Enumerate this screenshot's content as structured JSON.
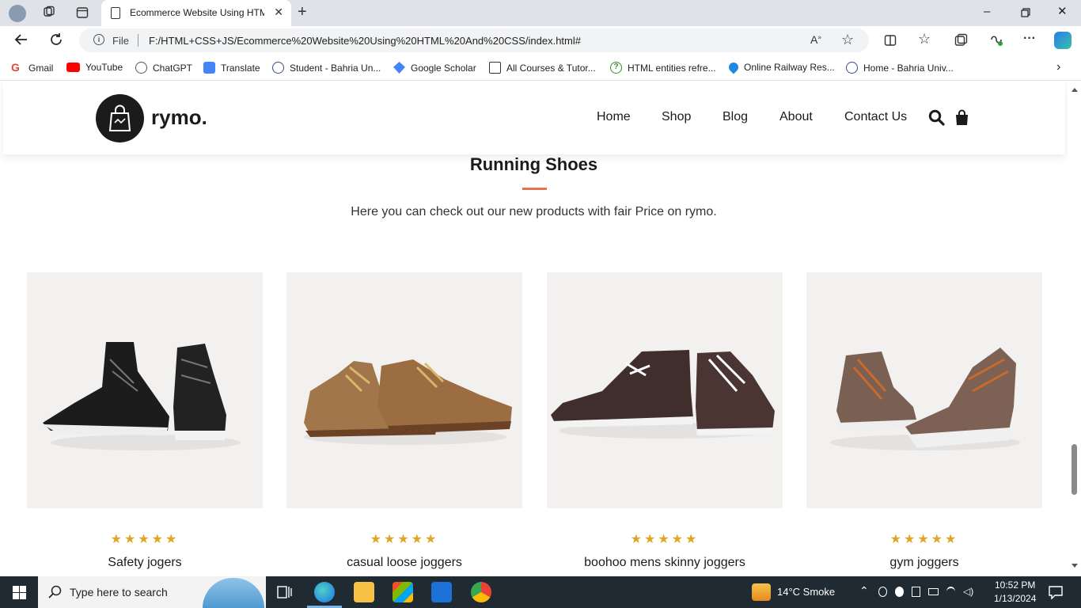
{
  "browser": {
    "tab_title": "Ecommerce Website Using HTML",
    "address_scheme": "File",
    "address_url": "F:/HTML+CSS+JS/Ecommerce%20Website%20Using%20HTML%20And%20CSS/index.html#",
    "bookmarks": [
      {
        "label": "Gmail",
        "icon": "gmail-icon",
        "color": "#ea4335"
      },
      {
        "label": "YouTube",
        "icon": "youtube-icon",
        "color": "#ff0000"
      },
      {
        "label": "ChatGPT",
        "icon": "chatgpt-icon",
        "color": "#555555"
      },
      {
        "label": "Translate",
        "icon": "translate-icon",
        "color": "#4285f4"
      },
      {
        "label": "Student - Bahria Un...",
        "icon": "bahria-icon",
        "color": "#3b4a8a"
      },
      {
        "label": "Google Scholar",
        "icon": "scholar-icon",
        "color": "#4285f4"
      },
      {
        "label": "All Courses & Tutor...",
        "icon": "courses-icon",
        "color": "#333333"
      },
      {
        "label": "HTML entities refre...",
        "icon": "html-entities-icon",
        "color": "#3a8a2a"
      },
      {
        "label": "Online Railway Res...",
        "icon": "railway-icon",
        "color": "#1e88e5"
      },
      {
        "label": "Home - Bahria Univ...",
        "icon": "bahria-icon",
        "color": "#3b4a8a"
      }
    ]
  },
  "site": {
    "logo_text": "rymo.",
    "nav": [
      "Home",
      "Shop",
      "Blog",
      "About",
      "Contact Us"
    ],
    "section_title": "Running Shoes",
    "section_subtitle": "Here you can check out our new products with fair Price on rymo.",
    "accent_color": "#e8734a",
    "star_color": "#e0a526",
    "products": [
      {
        "name": "Safety jogers",
        "rating": 5,
        "stars": "★★★★★"
      },
      {
        "name": "casual loose joggers",
        "rating": 5,
        "stars": "★★★★★"
      },
      {
        "name": "boohoo mens skinny joggers",
        "rating": 5,
        "stars": "★★★★★"
      },
      {
        "name": "gym joggers",
        "rating": 5,
        "stars": "★★★★★"
      }
    ]
  },
  "taskbar": {
    "search_placeholder": "Type here to search",
    "weather": "14°C  Smoke",
    "time": "10:52 PM",
    "date": "1/13/2024"
  }
}
